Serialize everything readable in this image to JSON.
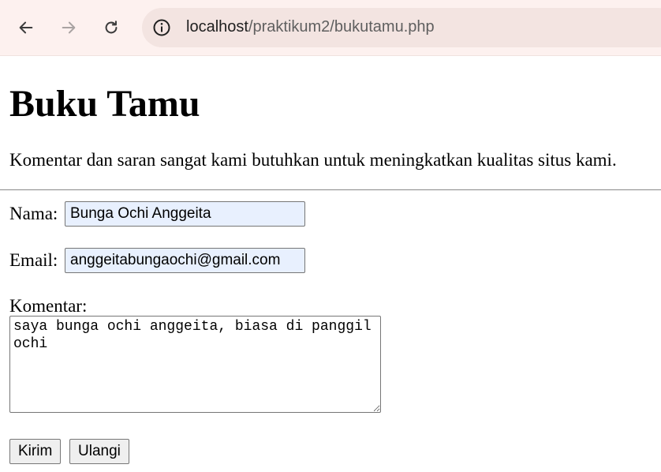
{
  "browser": {
    "url_host": "localhost",
    "url_path": "/praktikum2/bukutamu.php",
    "back_icon": "arrow-left-icon",
    "forward_icon": "arrow-right-icon",
    "reload_icon": "reload-icon",
    "site_info_icon": "info-circle-icon"
  },
  "page": {
    "title": "Buku Tamu",
    "intro": "Komentar dan saran sangat kami butuhkan untuk meningkatkan kualitas situs kami."
  },
  "form": {
    "name_label": "Nama:",
    "name_value": "Bunga Ochi Anggeita",
    "email_label": "Email:",
    "email_value": "anggeitabungaochi@gmail.com",
    "comment_label": "Komentar:",
    "comment_value": "saya bunga ochi anggeita, biasa di panggil ochi",
    "submit_label": "Kirim",
    "reset_label": "Ulangi"
  },
  "colors": {
    "toolbar_bg": "#fdf1ef",
    "autofill_bg": "#e8f0fe"
  }
}
